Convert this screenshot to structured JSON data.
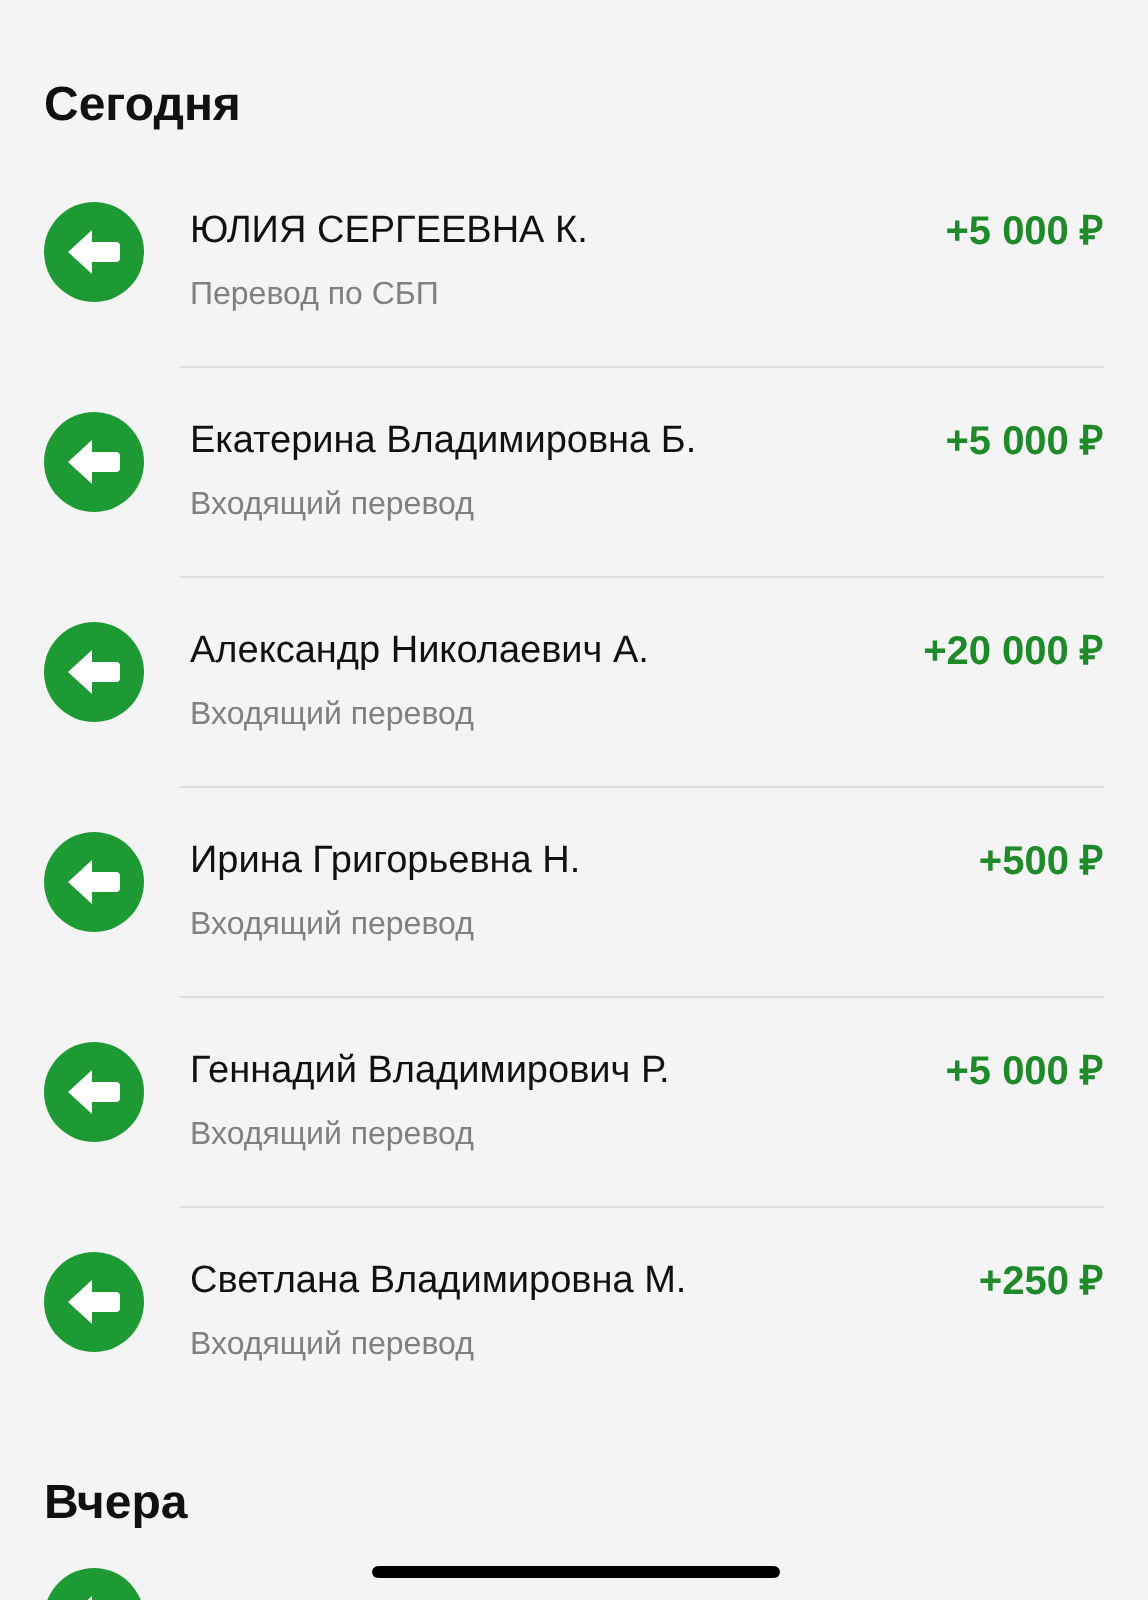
{
  "sections": [
    {
      "title": "Сегодня",
      "peek_icon": false,
      "transactions": [
        {
          "name": "ЮЛИЯ СЕРГЕЕВНА К.",
          "description": "Перевод по СБП",
          "amount": "+5 000 ₽"
        },
        {
          "name": "Екатерина Владимировна Б.",
          "description": "Входящий перевод",
          "amount": "+5 000 ₽"
        },
        {
          "name": "Александр Николаевич А.",
          "description": "Входящий перевод",
          "amount": "+20 000 ₽"
        },
        {
          "name": "Ирина Григорьевна Н.",
          "description": "Входящий перевод",
          "amount": "+500 ₽"
        },
        {
          "name": "Геннадий Владимирович Р.",
          "description": "Входящий перевод",
          "amount": "+5 000 ₽"
        },
        {
          "name": "Светлана Владимировна М.",
          "description": "Входящий перевод",
          "amount": "+250 ₽"
        }
      ]
    },
    {
      "title": "Вчера",
      "peek_icon": true
    }
  ]
}
